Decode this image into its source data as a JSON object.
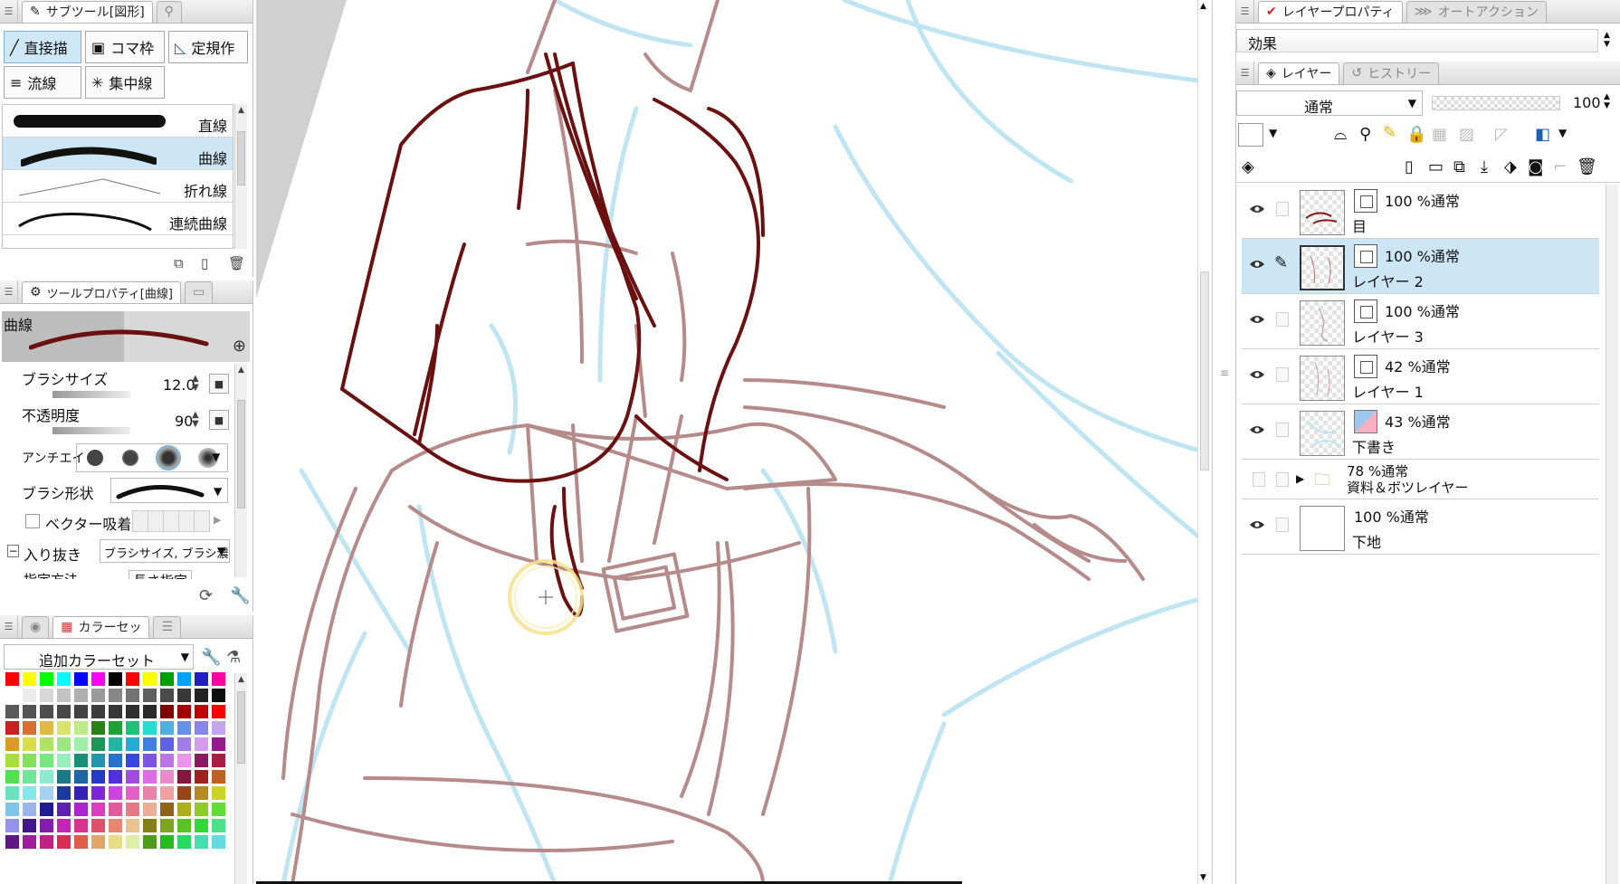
{
  "subtool_panel": {
    "title": "サブツール[図形]",
    "buttons": [
      "直接描",
      "コマ枠",
      "定規作",
      "流線",
      "集中線"
    ],
    "brushes": [
      "直線",
      "曲線",
      "折れ線",
      "連続曲線"
    ],
    "selected_brush": "曲線"
  },
  "tool_property": {
    "title": "ツールプロパティ[曲線]",
    "preview_label": "曲線",
    "brush_size_label": "ブラシサイズ",
    "brush_size": "12.0",
    "opacity_label": "不透明度",
    "opacity": "90",
    "antialias_label": "アンチエイ",
    "brush_shape_label": "ブラシ形状",
    "vector_snap_label": "ベクター吸着",
    "in_out_label": "入り抜き",
    "in_out_value": "ブラシサイズ, ブラシ濃度",
    "spec_label": "指定方法",
    "spec_value": "長さ指定"
  },
  "color_panel": {
    "tab_label": "カラーセッ",
    "set_name": "追加カラーセット"
  },
  "right_top": {
    "tab_active": "レイヤープロパティ",
    "tab_inactive": "オートアクション",
    "effect_label": "効果"
  },
  "layer_panel": {
    "tab_active": "レイヤー",
    "tab_inactive": "ヒストリー",
    "blend_mode": "通常",
    "opacity": "100",
    "layers": [
      {
        "mode": "100 %通常",
        "name": "目",
        "visible": true,
        "selected": false
      },
      {
        "mode": "100 %通常",
        "name": "レイヤー 2",
        "visible": true,
        "selected": true
      },
      {
        "mode": "100 %通常",
        "name": "レイヤー 3",
        "visible": true,
        "selected": false
      },
      {
        "mode": "42 %通常",
        "name": "レイヤー 1",
        "visible": true,
        "selected": false
      },
      {
        "mode": "43 %通常",
        "name": "下書き",
        "visible": true,
        "selected": false
      },
      {
        "mode": "78 %通常",
        "name": "資料＆ボツレイヤー",
        "visible": false,
        "selected": false
      },
      {
        "mode": "100 %通常",
        "name": "下地",
        "visible": true,
        "selected": false
      }
    ]
  },
  "colors": {
    "accent_selected": "#cde6f6",
    "line_art": "#6b1010",
    "sketch": "#b78a8a",
    "draft": "#bfe5f3"
  }
}
